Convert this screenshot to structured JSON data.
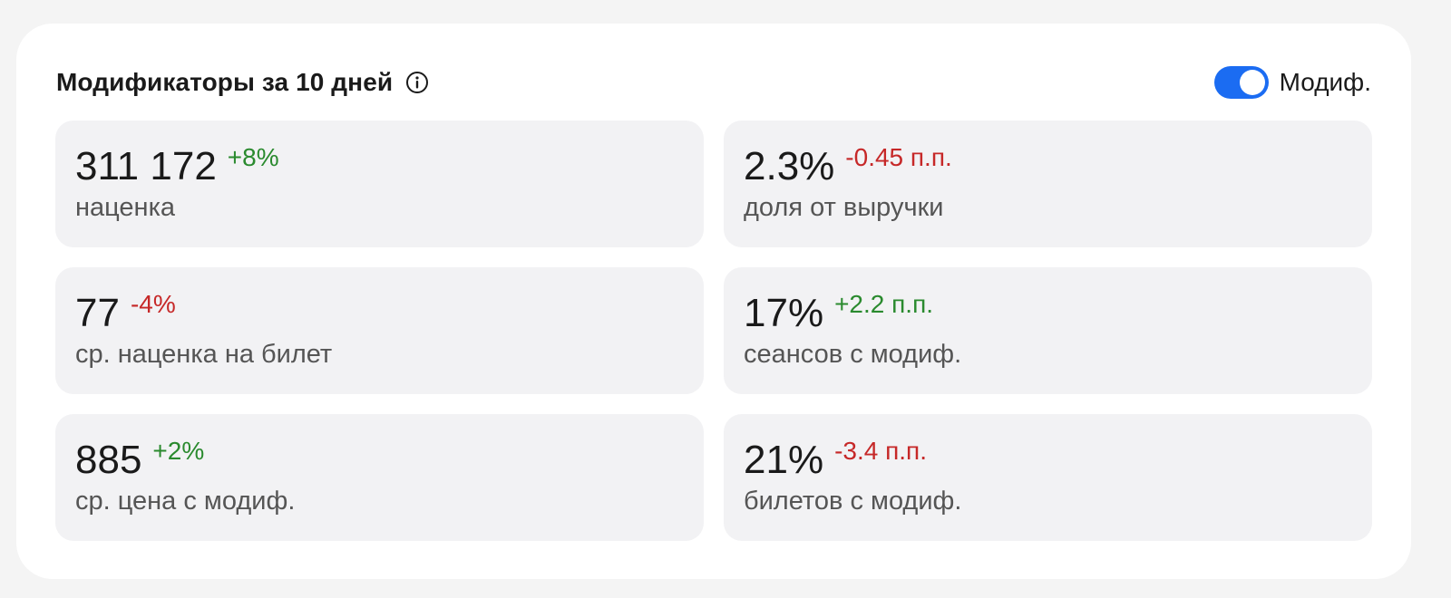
{
  "header": {
    "title": "Модификаторы за 10 дней",
    "toggle_label": "Модиф.",
    "toggle_on": true
  },
  "colors": {
    "accent": "#1b6cf2",
    "positive": "#2a8a2e",
    "negative": "#c62828",
    "card_bg": "#f2f2f4"
  },
  "metrics": [
    {
      "value": "311 172",
      "delta": "+8%",
      "trend": "up",
      "caption": "наценка"
    },
    {
      "value": "2.3%",
      "delta": "-0.45 п.п.",
      "trend": "down",
      "caption": "доля от выручки"
    },
    {
      "value": "77",
      "delta": "-4%",
      "trend": "down",
      "caption": "ср. наценка на билет"
    },
    {
      "value": "17%",
      "delta": "+2.2 п.п.",
      "trend": "up",
      "caption": "сеансов с модиф."
    },
    {
      "value": "885",
      "delta": "+2%",
      "trend": "up",
      "caption": "ср. цена с модиф."
    },
    {
      "value": "21%",
      "delta": "-3.4 п.п.",
      "trend": "down",
      "caption": "билетов с модиф."
    }
  ]
}
